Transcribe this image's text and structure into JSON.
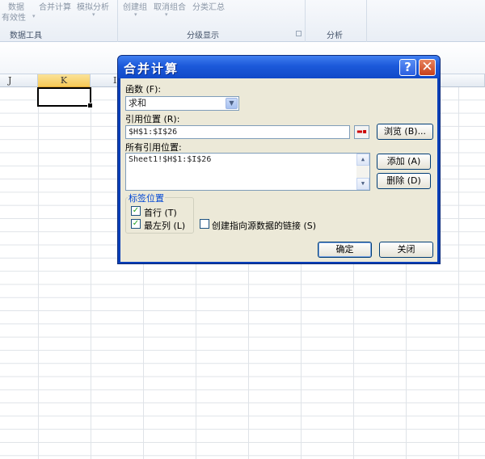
{
  "ribbon": {
    "data_label": "数据",
    "validity_label": "有效性",
    "consolidate_label": "合并计算",
    "whatif_label": "模拟分析",
    "group_label": "创建组",
    "ungroup_label": "取消组合",
    "subtotal_label": "分类汇总",
    "group_data_tools": "数据工具",
    "group_outline": "分级显示",
    "group_analysis": "分析"
  },
  "sheet": {
    "columns": [
      "J",
      "K",
      "I"
    ],
    "selected_column": "K"
  },
  "dialog": {
    "title": "合并计算",
    "help_glyph": "?",
    "close_glyph": "✕",
    "function_label": "函数 (F):",
    "function_value": "求和",
    "reference_label": "引用位置 (R):",
    "reference_value": "$H$1:$I$26",
    "browse_button": "浏览 (B)...",
    "all_references_label": "所有引用位置:",
    "all_references": [
      "Sheet1!$H$1:$I$26"
    ],
    "add_button": "添加 (A)",
    "delete_button": "删除 (D)",
    "label_position": "标签位置",
    "first_row": "首行 (T)",
    "left_column": "最左列 (L)",
    "create_links": "创建指向源数据的链接 (S)",
    "ok_button": "确定",
    "close_button": "关闭",
    "first_row_checked": true,
    "left_column_checked": true,
    "create_links_checked": false
  }
}
